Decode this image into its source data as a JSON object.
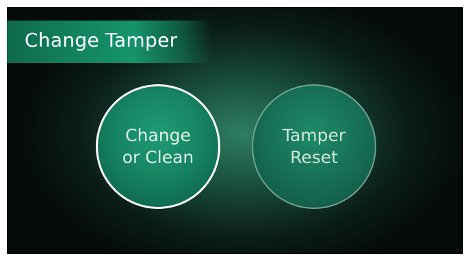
{
  "header": {
    "title": "Change Tamper"
  },
  "buttons": [
    {
      "line1": "Change",
      "line2": "or Clean",
      "state": "selected"
    },
    {
      "line1": "Tamper",
      "line2": "Reset",
      "state": "normal"
    }
  ],
  "colors": {
    "accent": "#168462",
    "title_bar": "#138a63",
    "background_center": "#2f7f62",
    "background_edge": "#050b09",
    "selected_border": "#ffffff"
  }
}
